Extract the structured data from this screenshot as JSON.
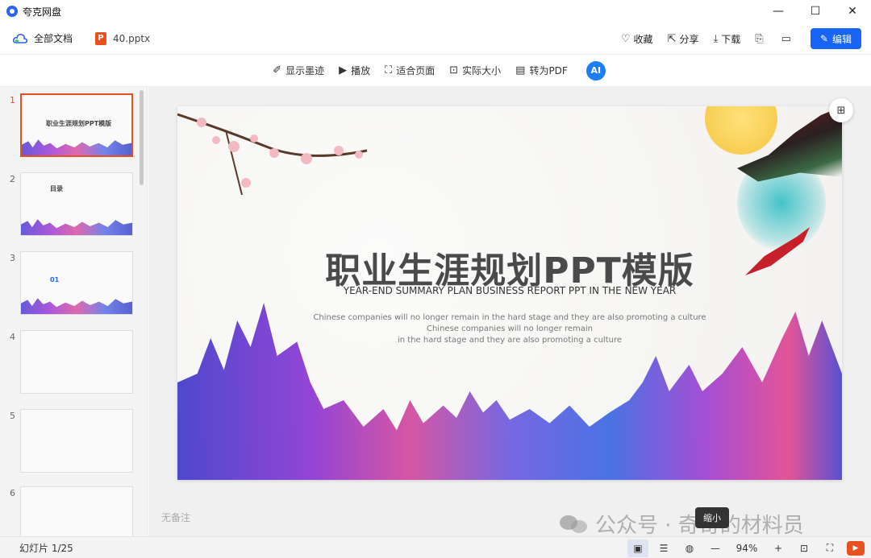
{
  "window": {
    "title": "夸克网盘",
    "minimize": "—",
    "maximize": "☐",
    "close": "✕"
  },
  "header": {
    "breadcrumb": "全部文档",
    "file_name": "40.pptx",
    "file_icon_letter": "P",
    "actions": {
      "favorite": "收藏",
      "share": "分享",
      "download": "下载",
      "edit": "编辑"
    }
  },
  "toolbar": {
    "show_ink": "显示墨迹",
    "play": "播放",
    "fit_page": "适合页面",
    "actual_size": "实际大小",
    "to_pdf": "转为PDF",
    "ai_label": "AI"
  },
  "sidebar": {
    "thumbnails": [
      {
        "number": "1",
        "title": "职业生涯规划PPT模版",
        "active": true
      },
      {
        "number": "2",
        "title": "目录",
        "active": false
      },
      {
        "number": "3",
        "title": "01",
        "active": false
      },
      {
        "number": "4",
        "title": "",
        "active": false
      },
      {
        "number": "5",
        "title": "",
        "active": false
      },
      {
        "number": "6",
        "title": "",
        "active": false
      }
    ]
  },
  "slide": {
    "title": "职业生涯规划PPT模版",
    "subtitle": "YEAR-END SUMMARY PLAN BUSINESS REPORT PPT IN THE NEW YEAR",
    "body_line1": "Chinese  companies  will no longer remain in the hard stage and they are also promoting a culture",
    "body_line2": "Chinese  companies  will no longer remain",
    "body_line3": "in the hard stage and they are also promoting a culture"
  },
  "notes": {
    "placeholder": "无备注"
  },
  "watermark": {
    "text": "公众号 · 奇奇的材料员"
  },
  "tooltip": {
    "text": "缩小"
  },
  "statusbar": {
    "slide_counter": "幻灯片 1/25",
    "zoom": "94%"
  },
  "colors": {
    "accent": "#1764f5",
    "ppt_orange": "#e8501f"
  }
}
